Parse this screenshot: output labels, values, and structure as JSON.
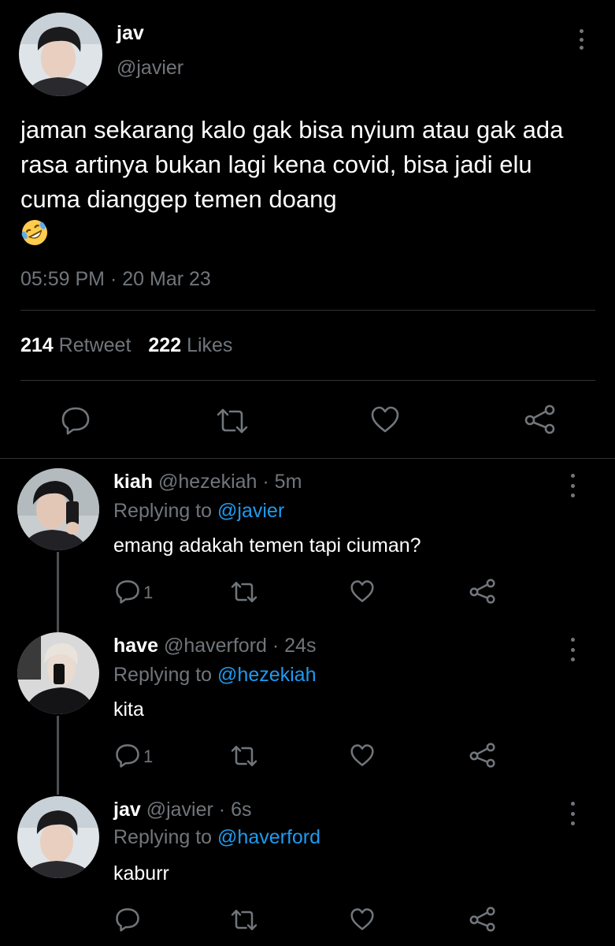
{
  "main_tweet": {
    "name": "jav",
    "handle": "@javier",
    "text": "jaman sekarang kalo gak bisa nyium atau gak ada rasa artinya bukan lagi kena covid, bisa jadi elu cuma dianggep temen doang",
    "emoji": "rolling-on-floor-laughing-emoji",
    "time": "05:59 PM",
    "date_sep": " · ",
    "date": "20 Mar 23",
    "retweets": "214",
    "retweet_label": "Retweet",
    "likes": "222",
    "likes_label": "Likes"
  },
  "replies": [
    {
      "name": "kiah",
      "handle": "@hezekiah",
      "age": "· 5m",
      "replying_label": "Replying to",
      "replying_to": "@javier",
      "text": "emang adakah temen tapi ciuman?",
      "reply_count": "1"
    },
    {
      "name": "have",
      "handle": "@haverford",
      "age": "· 24s",
      "replying_label": "Replying to",
      "replying_to": "@hezekiah",
      "text": "kita",
      "reply_count": "1"
    },
    {
      "name": "jav",
      "handle": "@javier",
      "age": "· 6s",
      "replying_label": "Replying to",
      "replying_to": "@haverford",
      "text": "kaburr",
      "reply_count": ""
    }
  ],
  "colors": {
    "background": "#000000",
    "text": "#ffffff",
    "muted": "#71767b",
    "link": "#1d9bf0",
    "divider": "#2f3336"
  },
  "icons": [
    "reply-icon",
    "retweet-icon",
    "like-icon",
    "share-icon",
    "more-options-icon"
  ]
}
